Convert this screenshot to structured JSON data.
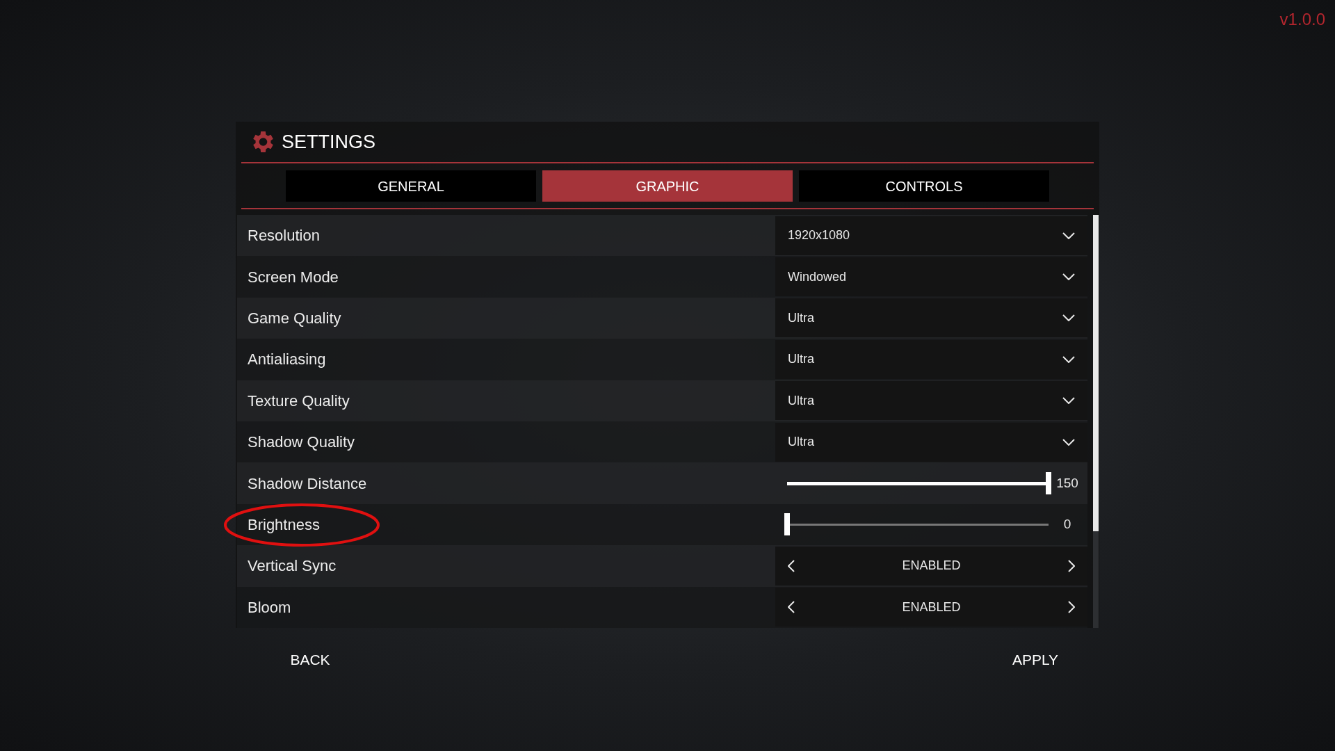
{
  "version": "v1.0.0",
  "title": "SETTINGS",
  "tabs": [
    {
      "label": "GENERAL",
      "selected": false
    },
    {
      "label": "GRAPHIC",
      "selected": true
    },
    {
      "label": "CONTROLS",
      "selected": false
    }
  ],
  "rows": [
    {
      "kind": "dropdown",
      "label": "Resolution",
      "value": "1920x1080"
    },
    {
      "kind": "dropdown",
      "label": "Screen Mode",
      "value": "Windowed"
    },
    {
      "kind": "dropdown",
      "label": "Game Quality",
      "value": "Ultra"
    },
    {
      "kind": "dropdown",
      "label": "Antialiasing",
      "value": "Ultra"
    },
    {
      "kind": "dropdown",
      "label": "Texture Quality",
      "value": "Ultra"
    },
    {
      "kind": "dropdown",
      "label": "Shadow Quality",
      "value": "Ultra"
    },
    {
      "kind": "slider",
      "label": "Shadow Distance",
      "level": 1.0,
      "reading": "150"
    },
    {
      "kind": "slider",
      "label": "Brightness",
      "level": 0.0,
      "reading": "0",
      "circled": true
    },
    {
      "kind": "toggle",
      "label": "Vertical Sync",
      "value": "ENABLED"
    },
    {
      "kind": "toggle",
      "label": "Bloom",
      "value": "ENABLED"
    }
  ],
  "footer": {
    "back": "BACK",
    "apply": "APPLY"
  }
}
